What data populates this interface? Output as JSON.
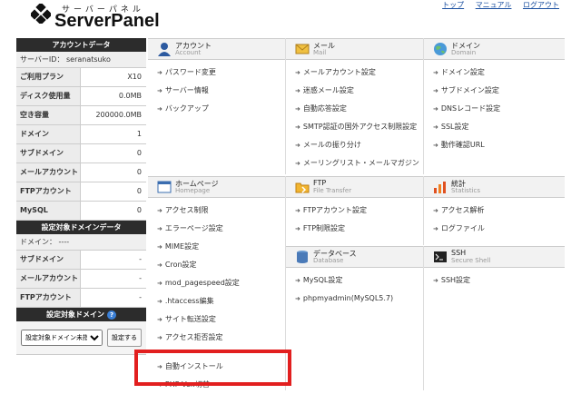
{
  "header": {
    "logo_kana": "サーバーパネル",
    "logo_text": "ServerPanel",
    "links": [
      "トップ",
      "マニュアル",
      "ログアウト"
    ]
  },
  "sidebar": {
    "account_title": "アカウントデータ",
    "server_id": "サーバーID：  seranatsuko",
    "rows": [
      {
        "k": "ご利用プラン",
        "v": "X10"
      },
      {
        "k": "ディスク使用量",
        "v": "0.0MB"
      },
      {
        "k": "空き容量",
        "v": "200000.0MB"
      },
      {
        "k": "ドメイン",
        "v": "1"
      },
      {
        "k": "サブドメイン",
        "v": "0"
      },
      {
        "k": "メールアカウント",
        "v": "0"
      },
      {
        "k": "FTPアカウント",
        "v": "0"
      },
      {
        "k": "MySQL",
        "v": "0"
      }
    ],
    "target_title": "設定対象ドメインデータ",
    "target_domain": "ドメイン：  ----",
    "target_rows": [
      {
        "k": "サブドメイン",
        "v": "-"
      },
      {
        "k": "メールアカウント",
        "v": "-"
      },
      {
        "k": "FTPアカウント",
        "v": "-"
      }
    ],
    "select_title": "設定対象ドメイン",
    "select_value": "設定対象ドメイン未指定",
    "set_button": "設定する"
  },
  "panels": {
    "account": {
      "title": "アカウント",
      "sub": "Account",
      "items": [
        "パスワード変更",
        "サーバー情報",
        "バックアップ"
      ]
    },
    "mail": {
      "title": "メール",
      "sub": "Mail",
      "items": [
        "メールアカウント設定",
        "迷惑メール設定",
        "自動応答設定",
        "SMTP認証の国外アクセス制限設定",
        "メールの振り分け",
        "メーリングリスト・メールマガジン"
      ]
    },
    "domain": {
      "title": "ドメイン",
      "sub": "Domain",
      "items": [
        "ドメイン設定",
        "サブドメイン設定",
        "DNSレコード設定",
        "SSL設定",
        "動作確認URL"
      ]
    },
    "homepage": {
      "title": "ホームページ",
      "sub": "Homepage",
      "items": [
        "アクセス制限",
        "エラーページ設定",
        "MIME設定",
        "Cron設定",
        "mod_pagespeed設定",
        ".htaccess編集",
        "サイト転送設定",
        "アクセス拒否設定",
        "",
        "自動インストール",
        "PHP Ver.切替"
      ]
    },
    "ftp": {
      "title": "FTP",
      "sub": "File Transfer",
      "items": [
        "FTPアカウント設定",
        "FTP制限設定"
      ]
    },
    "stats": {
      "title": "統計",
      "sub": "Statistics",
      "items": [
        "アクセス解析",
        "ログファイル"
      ]
    },
    "database": {
      "title": "データベース",
      "sub": "Database",
      "items": [
        "MySQL設定",
        "phpmyadmin(MySQL5.7)"
      ]
    },
    "ssh": {
      "title": "SSH",
      "sub": "Secure Shell",
      "items": [
        "SSH設定"
      ]
    }
  },
  "colors": {
    "highlight": "#e21f1f",
    "link": "#1a4fa0",
    "sidebar_header": "#2c2c2c"
  }
}
